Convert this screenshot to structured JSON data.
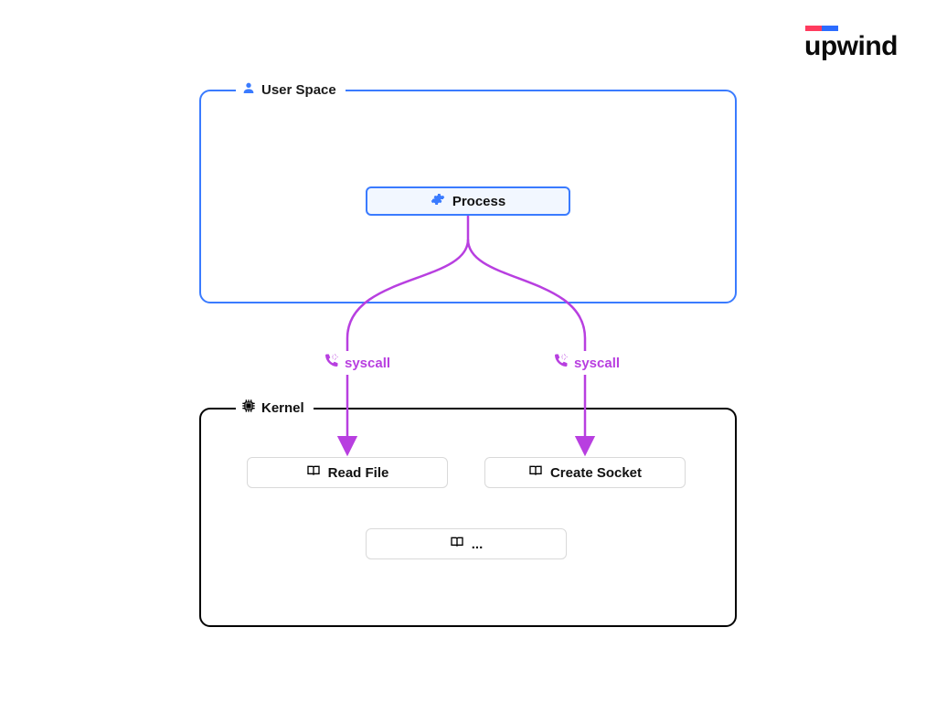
{
  "brand": {
    "name": "upwind",
    "accent1": "#ff3b5e",
    "accent2": "#2c6cff"
  },
  "user_space": {
    "title": "User Space",
    "process_label": "Process"
  },
  "kernel": {
    "title": "Kernel",
    "functions": {
      "read_file": "Read File",
      "create_socket": "Create Socket",
      "more": "..."
    }
  },
  "edges": {
    "left_label": "syscall",
    "right_label": "syscall",
    "color": "#b83fe0"
  }
}
